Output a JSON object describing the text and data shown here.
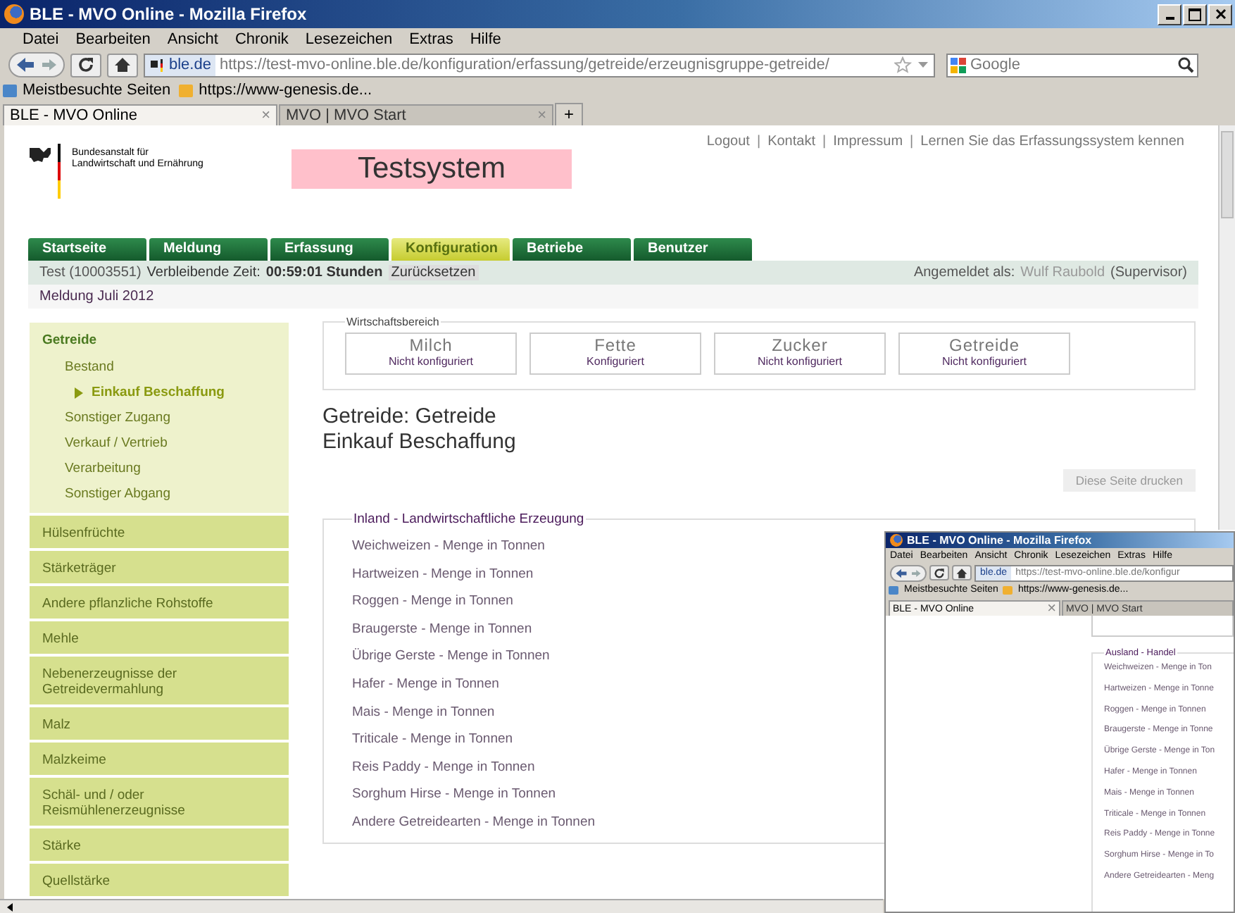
{
  "browser": {
    "title": "BLE - MVO Online - Mozilla Firefox",
    "menu": [
      "Datei",
      "Bearbeiten",
      "Ansicht",
      "Chronik",
      "Lesezeichen",
      "Extras",
      "Hilfe"
    ],
    "site_badge": "ble.de",
    "url": "https://test-mvo-online.ble.de/konfiguration/erfassung/getreide/erzeugnisgruppe-getreide/",
    "search_placeholder": "Google",
    "bookmarks": [
      "Meistbesuchte Seiten",
      "https://www-genesis.de..."
    ],
    "tabs": [
      {
        "label": "BLE - MVO Online",
        "selected": true,
        "close": "×"
      },
      {
        "label": "MVO | MVO Start",
        "selected": false,
        "close": "×"
      }
    ],
    "new_tab": "+"
  },
  "header": {
    "links": [
      "Logout",
      "Kontakt",
      "Impressum",
      "Lernen Sie das Erfassungssystem kennen"
    ],
    "separator": "|",
    "agency": [
      "Bundesanstalt für",
      "Landwirtschaft und Ernährung"
    ],
    "banner": "Testsystem"
  },
  "nav_tabs": [
    {
      "label": "Startseite",
      "selected": false
    },
    {
      "label": "Meldung",
      "selected": false
    },
    {
      "label": "Erfassung",
      "selected": false
    },
    {
      "label": "Konfiguration",
      "selected": true
    },
    {
      "label": "Betriebe",
      "selected": false
    },
    {
      "label": "Benutzer",
      "selected": false
    }
  ],
  "info_bar": {
    "account": "Test (10003551)",
    "time_label": "Verbleibende Zeit:",
    "time": "00:59:01 Stunden",
    "reset": "Zurücksetzen",
    "login_label": "Angemeldet als:",
    "user": "Wulf Raubold",
    "role": "(Supervisor)"
  },
  "report": "Meldung Juli 2012",
  "sidebar": {
    "groups": [
      {
        "label": "Getreide",
        "expanded": true,
        "children": [
          {
            "label": "Bestand",
            "selected": false
          },
          {
            "label": "Einkauf Beschaffung",
            "selected": true
          },
          {
            "label": "Sonstiger Zugang",
            "selected": false
          },
          {
            "label": "Verkauf / Vertrieb",
            "selected": false
          },
          {
            "label": "Verarbeitung",
            "selected": false
          },
          {
            "label": "Sonstiger Abgang",
            "selected": false
          }
        ]
      },
      {
        "label": "Hülsenfrüchte",
        "expanded": false
      },
      {
        "label": "Stärketräger",
        "expanded": false
      },
      {
        "label": "Andere pflanzliche Rohstoffe",
        "expanded": false
      },
      {
        "label": "Mehle",
        "expanded": false
      },
      {
        "label": "Nebenerzeugnisse der Getreidevermahlung",
        "expanded": false
      },
      {
        "label": "Malz",
        "expanded": false
      },
      {
        "label": "Malzkeime",
        "expanded": false
      },
      {
        "label": "Schäl- und / oder Reismühlenerzeugnisse",
        "expanded": false
      },
      {
        "label": "Stärke",
        "expanded": false
      },
      {
        "label": "Quellstärke",
        "expanded": false
      }
    ]
  },
  "sectors": {
    "legend": "Wirtschaftsbereich",
    "items": [
      {
        "name": "Milch",
        "status": "Nicht konfiguriert"
      },
      {
        "name": "Fette",
        "status": "Konfiguriert"
      },
      {
        "name": "Zucker",
        "status": "Nicht konfiguriert"
      },
      {
        "name": "Getreide",
        "status": "Nicht konfiguriert"
      }
    ]
  },
  "heading": [
    "Getreide: Getreide",
    "Einkauf Beschaffung"
  ],
  "print_button": "Diese Seite drucken",
  "inland": {
    "legend": "Inland - Landwirtschaftliche Erzeugung",
    "items": [
      "Weichweizen - Menge in Tonnen",
      "Hartweizen - Menge in Tonnen",
      "Roggen - Menge in Tonnen",
      "Braugerste - Menge in Tonnen",
      "Übrige Gerste - Menge in Tonnen",
      "Hafer - Menge in Tonnen",
      "Mais - Menge in Tonnen",
      "Triticale - Menge in Tonnen",
      "Reis Paddy - Menge in Tonnen",
      "Sorghum Hirse - Menge in Tonnen",
      "Andere Getreidearten - Menge in Tonnen"
    ]
  },
  "overlay_window": {
    "title": "BLE - MVO Online - Mozilla Firefox",
    "menu": [
      "Datei",
      "Bearbeiten",
      "Ansicht",
      "Chronik",
      "Lesezeichen",
      "Extras",
      "Hilfe"
    ],
    "site_badge": "ble.de",
    "url": "https://test-mvo-online.ble.de/konfigur",
    "bookmarks": [
      "Meistbesuchte Seiten",
      "https://www-genesis.de..."
    ],
    "tabs": [
      {
        "label": "BLE - MVO Online",
        "selected": true,
        "close": "×"
      },
      {
        "label": "MVO | MVO Start",
        "selected": false
      }
    ],
    "ausland": {
      "legend": "Ausland - Handel",
      "items": [
        "Weichweizen - Menge in Ton",
        "Hartweizen - Menge in Tonne",
        "Roggen - Menge in Tonnen",
        "Braugerste - Menge in Tonne",
        "Übrige Gerste - Menge in Ton",
        "Hafer - Menge in Tonnen",
        "Mais - Menge in Tonnen",
        "Triticale - Menge in Tonnen",
        "Reis Paddy - Menge in Tonne",
        "Sorghum Hirse - Menge in To",
        "Andere Getreidearten - Meng"
      ]
    }
  }
}
